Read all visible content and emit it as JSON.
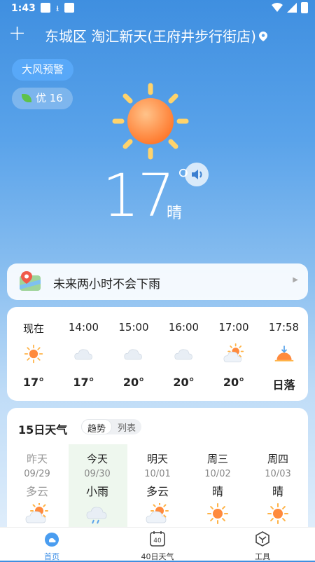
{
  "status_bar": {
    "time": "1:43"
  },
  "header": {
    "add_glyph": "+",
    "location": "东城区 淘汇新天(王府井步行街店)"
  },
  "alerts": {
    "warning": "大风预警",
    "aqi": "优 16"
  },
  "current": {
    "temperature": "17",
    "degree": "°",
    "condition": "晴"
  },
  "rain_forecast": {
    "text": "未来两小时不会下雨"
  },
  "hourly": [
    {
      "time": "现在",
      "temp": "17°",
      "icon": "sun-icon"
    },
    {
      "time": "14:00",
      "temp": "17°",
      "icon": "cloud-icon"
    },
    {
      "time": "15:00",
      "temp": "20°",
      "icon": "cloud-icon"
    },
    {
      "time": "16:00",
      "temp": "20°",
      "icon": "cloud-icon"
    },
    {
      "time": "17:00",
      "temp": "20°",
      "icon": "partly-cloudy-icon"
    },
    {
      "time": "17:58",
      "temp": "日落",
      "icon": "sunset-icon"
    }
  ],
  "daily": {
    "title": "15日天气",
    "toggle": {
      "trend": "趋势",
      "list": "列表"
    },
    "days": [
      {
        "name": "昨天",
        "date": "09/29",
        "condition": "多云",
        "icon": "partly-cloudy-icon"
      },
      {
        "name": "今天",
        "date": "09/30",
        "condition": "小雨",
        "icon": "rain-icon"
      },
      {
        "name": "明天",
        "date": "10/01",
        "condition": "多云",
        "icon": "partly-cloudy-icon"
      },
      {
        "name": "周三",
        "date": "10/02",
        "condition": "晴",
        "icon": "sun-icon"
      },
      {
        "name": "周四",
        "date": "10/03",
        "condition": "晴",
        "icon": "sun-icon"
      }
    ]
  },
  "bottom_nav": [
    {
      "label": "首页",
      "icon": "home-weather-icon",
      "active": true
    },
    {
      "label": "40日天气",
      "icon": "calendar-40-icon",
      "badge": "40"
    },
    {
      "label": "工具",
      "icon": "tools-icon"
    }
  ],
  "colors": {
    "accent": "#3b8de6",
    "sun": "#ff8a3d",
    "today_bg": "#eef7ee"
  }
}
